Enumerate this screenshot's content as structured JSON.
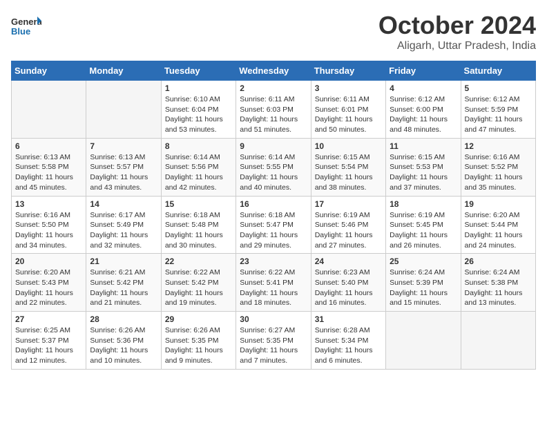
{
  "header": {
    "logo_line1": "General",
    "logo_line2": "Blue",
    "month": "October 2024",
    "location": "Aligarh, Uttar Pradesh, India"
  },
  "days_of_week": [
    "Sunday",
    "Monday",
    "Tuesday",
    "Wednesday",
    "Thursday",
    "Friday",
    "Saturday"
  ],
  "weeks": [
    [
      {
        "day": "",
        "empty": true
      },
      {
        "day": "",
        "empty": true
      },
      {
        "day": "1",
        "sunrise": "6:10 AM",
        "sunset": "6:04 PM",
        "daylight": "11 hours and 53 minutes."
      },
      {
        "day": "2",
        "sunrise": "6:11 AM",
        "sunset": "6:03 PM",
        "daylight": "11 hours and 51 minutes."
      },
      {
        "day": "3",
        "sunrise": "6:11 AM",
        "sunset": "6:01 PM",
        "daylight": "11 hours and 50 minutes."
      },
      {
        "day": "4",
        "sunrise": "6:12 AM",
        "sunset": "6:00 PM",
        "daylight": "11 hours and 48 minutes."
      },
      {
        "day": "5",
        "sunrise": "6:12 AM",
        "sunset": "5:59 PM",
        "daylight": "11 hours and 47 minutes."
      }
    ],
    [
      {
        "day": "6",
        "sunrise": "6:13 AM",
        "sunset": "5:58 PM",
        "daylight": "11 hours and 45 minutes."
      },
      {
        "day": "7",
        "sunrise": "6:13 AM",
        "sunset": "5:57 PM",
        "daylight": "11 hours and 43 minutes."
      },
      {
        "day": "8",
        "sunrise": "6:14 AM",
        "sunset": "5:56 PM",
        "daylight": "11 hours and 42 minutes."
      },
      {
        "day": "9",
        "sunrise": "6:14 AM",
        "sunset": "5:55 PM",
        "daylight": "11 hours and 40 minutes."
      },
      {
        "day": "10",
        "sunrise": "6:15 AM",
        "sunset": "5:54 PM",
        "daylight": "11 hours and 38 minutes."
      },
      {
        "day": "11",
        "sunrise": "6:15 AM",
        "sunset": "5:53 PM",
        "daylight": "11 hours and 37 minutes."
      },
      {
        "day": "12",
        "sunrise": "6:16 AM",
        "sunset": "5:52 PM",
        "daylight": "11 hours and 35 minutes."
      }
    ],
    [
      {
        "day": "13",
        "sunrise": "6:16 AM",
        "sunset": "5:50 PM",
        "daylight": "11 hours and 34 minutes."
      },
      {
        "day": "14",
        "sunrise": "6:17 AM",
        "sunset": "5:49 PM",
        "daylight": "11 hours and 32 minutes."
      },
      {
        "day": "15",
        "sunrise": "6:18 AM",
        "sunset": "5:48 PM",
        "daylight": "11 hours and 30 minutes."
      },
      {
        "day": "16",
        "sunrise": "6:18 AM",
        "sunset": "5:47 PM",
        "daylight": "11 hours and 29 minutes."
      },
      {
        "day": "17",
        "sunrise": "6:19 AM",
        "sunset": "5:46 PM",
        "daylight": "11 hours and 27 minutes."
      },
      {
        "day": "18",
        "sunrise": "6:19 AM",
        "sunset": "5:45 PM",
        "daylight": "11 hours and 26 minutes."
      },
      {
        "day": "19",
        "sunrise": "6:20 AM",
        "sunset": "5:44 PM",
        "daylight": "11 hours and 24 minutes."
      }
    ],
    [
      {
        "day": "20",
        "sunrise": "6:20 AM",
        "sunset": "5:43 PM",
        "daylight": "11 hours and 22 minutes."
      },
      {
        "day": "21",
        "sunrise": "6:21 AM",
        "sunset": "5:42 PM",
        "daylight": "11 hours and 21 minutes."
      },
      {
        "day": "22",
        "sunrise": "6:22 AM",
        "sunset": "5:42 PM",
        "daylight": "11 hours and 19 minutes."
      },
      {
        "day": "23",
        "sunrise": "6:22 AM",
        "sunset": "5:41 PM",
        "daylight": "11 hours and 18 minutes."
      },
      {
        "day": "24",
        "sunrise": "6:23 AM",
        "sunset": "5:40 PM",
        "daylight": "11 hours and 16 minutes."
      },
      {
        "day": "25",
        "sunrise": "6:24 AM",
        "sunset": "5:39 PM",
        "daylight": "11 hours and 15 minutes."
      },
      {
        "day": "26",
        "sunrise": "6:24 AM",
        "sunset": "5:38 PM",
        "daylight": "11 hours and 13 minutes."
      }
    ],
    [
      {
        "day": "27",
        "sunrise": "6:25 AM",
        "sunset": "5:37 PM",
        "daylight": "11 hours and 12 minutes."
      },
      {
        "day": "28",
        "sunrise": "6:26 AM",
        "sunset": "5:36 PM",
        "daylight": "11 hours and 10 minutes."
      },
      {
        "day": "29",
        "sunrise": "6:26 AM",
        "sunset": "5:35 PM",
        "daylight": "11 hours and 9 minutes."
      },
      {
        "day": "30",
        "sunrise": "6:27 AM",
        "sunset": "5:35 PM",
        "daylight": "11 hours and 7 minutes."
      },
      {
        "day": "31",
        "sunrise": "6:28 AM",
        "sunset": "5:34 PM",
        "daylight": "11 hours and 6 minutes."
      },
      {
        "day": "",
        "empty": true
      },
      {
        "day": "",
        "empty": true
      }
    ]
  ]
}
